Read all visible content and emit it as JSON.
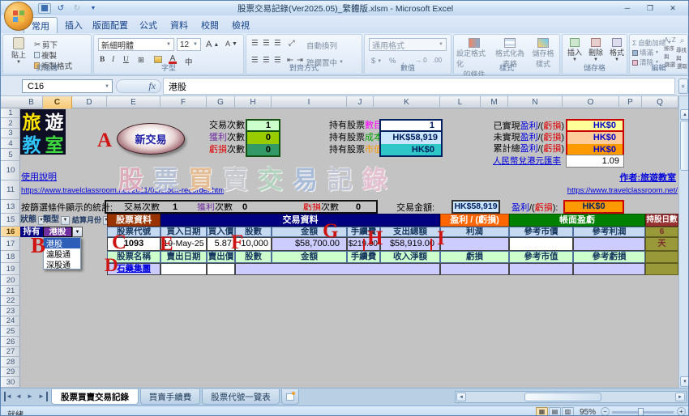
{
  "window": {
    "title": "股票交易記錄(Ver2025.05)_繁體版.xlsm - Microsoft Excel"
  },
  "icons": {
    "dd": "▼",
    "up": "▲",
    "down": "▼",
    "left": "◄",
    "right": "►",
    "scissors": "✂",
    "sum": "Σ",
    "undo": "↺",
    "redo": "↻",
    "help": "?",
    "min": "─",
    "max": "❐",
    "close": "✕",
    "chevrons": "»",
    "view_normal": "▦",
    "view_layout": "▤",
    "view_break": "▥",
    "minus": "−",
    "plus": "+",
    "fx": "fx",
    "bold": "B",
    "italic": "I",
    "underline": "U",
    "border": "⊞",
    "font_a": "A",
    "phonetic": "中",
    "align": "☰",
    "money": "$",
    "pct": "%",
    "comma": ",",
    "sort_az": "A↓Z",
    "find": "⌕"
  },
  "ribbon": {
    "tabs": [
      "常用",
      "插入",
      "版面配置",
      "公式",
      "資料",
      "校閱",
      "檢視"
    ],
    "clipboard": {
      "label": "剪貼簿",
      "paste": "貼上",
      "cut": "剪下",
      "copy": "複製",
      "painter": "複製格式"
    },
    "font": {
      "label": "字型",
      "name": "新細明體",
      "size": "12"
    },
    "alignment": {
      "label": "對齊方式",
      "wrap": "自動換列",
      "merge": "跨欄置中"
    },
    "number": {
      "label": "數值",
      "format": "通用格式"
    },
    "styles": {
      "label": "樣式",
      "cond1": "設定格式化",
      "cond2": "的條件",
      "tbl1": "格式化為",
      "tbl2": "表格",
      "cs1": "儲存格",
      "cs2": "樣式"
    },
    "cells": {
      "label": "儲存格",
      "insert": "插入",
      "del": "刪除",
      "fmt": "格式"
    },
    "editing": {
      "label": "編輯",
      "sum": "自動加總",
      "fill": "填滿",
      "clear": "清除",
      "sort1": "排序與",
      "sort2": "篩選",
      "find1": "尋找與",
      "find2": "選取"
    }
  },
  "formula_bar": {
    "name_box": "C16",
    "value": "港股"
  },
  "grid": {
    "columns": [
      "B",
      "C",
      "D",
      "E",
      "F",
      "G",
      "H",
      "I",
      "J",
      "K",
      "L",
      "M",
      "N",
      "O",
      "P",
      "Q"
    ],
    "rows": [
      "1",
      "2",
      "3",
      "4",
      "5",
      "10",
      "11",
      "13",
      "15",
      "16",
      "17",
      "18",
      "19",
      "20",
      "21",
      "22",
      "23",
      "24",
      "25",
      "26",
      "27",
      "28",
      "29",
      "30"
    ]
  },
  "logo": {
    "chars": [
      "旅",
      "遊",
      "教",
      "室"
    ]
  },
  "annotations": [
    "A",
    "B",
    "C",
    "D",
    "E",
    "F",
    "G",
    "H",
    "I"
  ],
  "button_new_trade": "新交易",
  "summary": {
    "trades": {
      "label": "交易次數",
      "value": "1"
    },
    "wins": {
      "head": "獲利",
      "tail": "次數",
      "value": "0"
    },
    "losses": {
      "head": "虧損",
      "tail": "次數",
      "value": "0"
    },
    "hold_count": {
      "head": "持有股票",
      "tail": "數目",
      "value": "1"
    },
    "hold_cost": {
      "head": "持有股票",
      "tail": "成本",
      "value": "HK$58,919"
    },
    "hold_value": {
      "head": "持有股票",
      "tail": "市值",
      "value": "HK$0"
    },
    "pnl": {
      "profit": "盈利",
      "slash": "/(",
      "loss": "虧損",
      "close": ")",
      "rows": [
        {
          "prefix": "已實現",
          "value": "HK$0"
        },
        {
          "prefix": "未實現",
          "value": "HK$0"
        },
        {
          "prefix": "累計總",
          "value": "HK$0"
        }
      ]
    },
    "fx_rate": {
      "label": "人民幣兌港元匯率",
      "value": "1.09"
    }
  },
  "links": {
    "help": "使用說明",
    "page_url": "https://www.travelclassroom.net/2011/02/stock-recorder.html",
    "author": "作者:旅遊教室",
    "site_url": "https://www.travelclassroom.net/"
  },
  "watermark": [
    "股",
    "票",
    "買",
    "賣",
    "交",
    "易",
    "記",
    "錄"
  ],
  "filter_stats": {
    "caption": "按篩選條件顯示的統計:",
    "trades_label": "交易次數",
    "trades": "1",
    "wins_head": "獲利",
    "wins_tail": "次數",
    "wins": "0",
    "loss_head": "虧損",
    "loss_tail": "次數",
    "loss": "0",
    "amount_label": "交易金額:",
    "amount": "HK$58,919",
    "pnl_colon": "):",
    "pnl": "HK$0"
  },
  "table": {
    "filters": [
      {
        "label": "狀態"
      },
      {
        "label": "類型"
      },
      {
        "label": "結算月份"
      }
    ],
    "sections": {
      "stock": "股票資料",
      "trade": "交易資料",
      "pnl": "盈利 / (虧損)",
      "book": "帳面盈虧",
      "days": "持股日數"
    },
    "state": "持有",
    "type": "港股",
    "dropdown": [
      "港股",
      "滬股通",
      "深股通"
    ],
    "buy_headers": [
      "股票代號",
      "買入日期",
      "買入價",
      "股數",
      "金額",
      "手續費",
      "支出總額",
      "利潤",
      "參考市價",
      "參考利潤"
    ],
    "buy": {
      "code": "1093",
      "date": "19-May-25",
      "price": "5.87",
      "qty": "10,000",
      "amount": "$58,700.00",
      "fee": "$219.00",
      "total": "$58,919.00"
    },
    "sell_headers": [
      "股票名稱",
      "賣出日期",
      "賣出價",
      "股數",
      "金額",
      "手續費",
      "收入淨額",
      "虧損",
      "參考市值",
      "參考虧損"
    ],
    "stock_name": "石藥集團",
    "days": "6",
    "days_unit": "天"
  },
  "sheet_tabs": [
    "股票買賣交易記錄",
    "買賣手續費",
    "股票代號一覽表"
  ],
  "status": {
    "ready": "就緒",
    "zoom": "95%"
  }
}
